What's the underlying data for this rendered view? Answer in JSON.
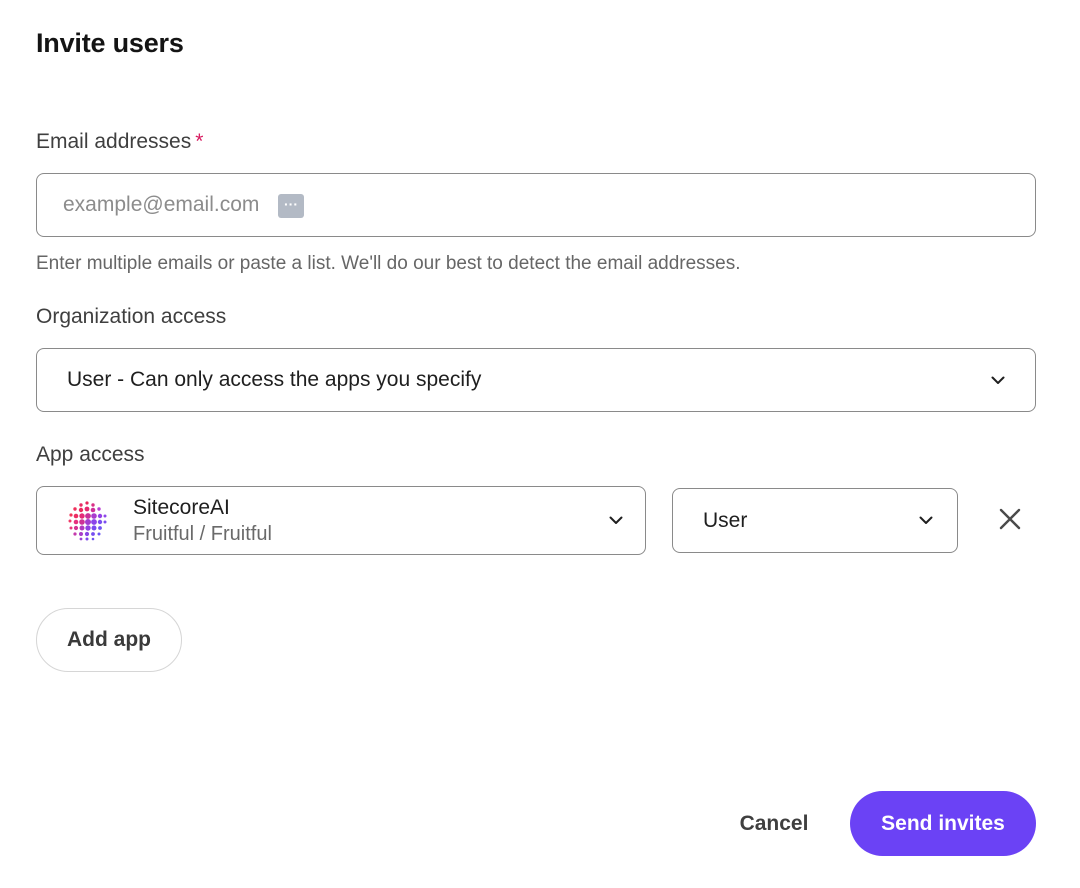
{
  "dialog": {
    "title": "Invite users"
  },
  "email": {
    "label": "Email addresses",
    "required_marker": "*",
    "placeholder": "example@email.com",
    "value": "",
    "helper": "Enter multiple emails or paste a list. We'll do our best to detect the email addresses.",
    "autofill_badge_icon": "password-manager-icon",
    "autofill_badge_text": "···"
  },
  "organization_access": {
    "label": "Organization access",
    "selected": "User - Can only access the apps you specify",
    "icon": "chevron-down-icon"
  },
  "app_access": {
    "label": "App access",
    "rows": [
      {
        "app_name": "SitecoreAI",
        "app_subtitle": "Fruitful / Fruitful",
        "app_logo_icon": "sitecore-logo-icon",
        "role": "User",
        "remove_icon": "close-icon"
      }
    ],
    "add_label": "Add app"
  },
  "actions": {
    "cancel_label": "Cancel",
    "send_label": "Send invites"
  },
  "colors": {
    "primary": "#6b42f5",
    "required": "#d81b60",
    "border": "#8a8a8a",
    "helper_text": "#666666"
  }
}
